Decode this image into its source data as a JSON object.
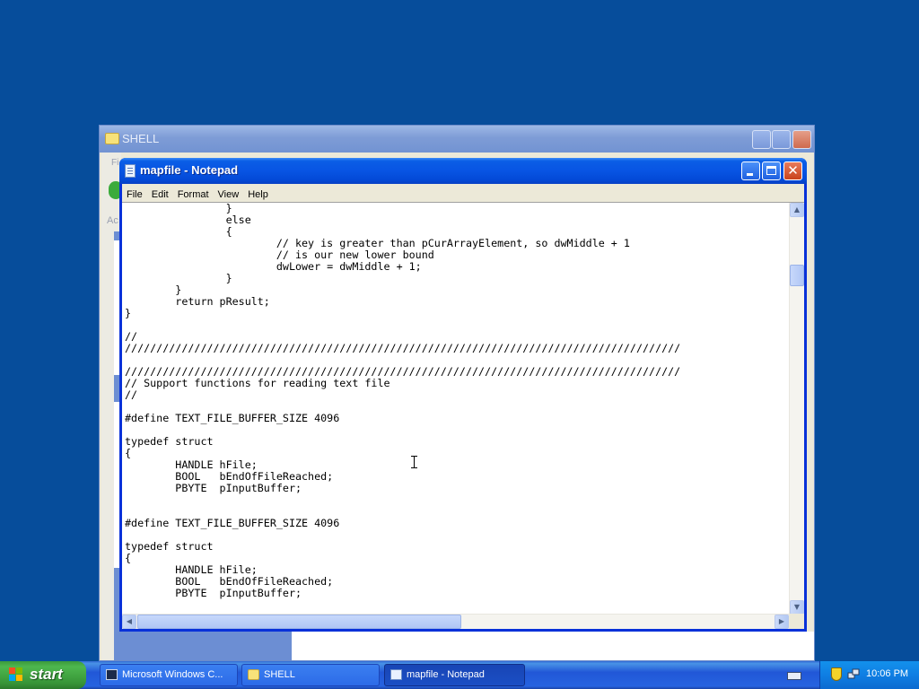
{
  "shell_window": {
    "title": "SHELL",
    "fragment_menu": "Fi",
    "fragment_address": "Ac"
  },
  "notepad": {
    "title": "mapfile - Notepad",
    "menu": [
      "File",
      "Edit",
      "Format",
      "View",
      "Help"
    ],
    "lines": [
      "                }",
      "                else",
      "                {",
      "                        // key is greater than pCurArrayElement, so dwMiddle + 1",
      "                        // is our new lower bound",
      "                        dwLower = dwMiddle + 1;",
      "                }",
      "        }",
      "        return pResult;",
      "}",
      "",
      "//",
      "////////////////////////////////////////////////////////////////////////////////////////",
      "",
      "////////////////////////////////////////////////////////////////////////////////////////",
      "// Support functions for reading text file",
      "//",
      "",
      "#define TEXT_FILE_BUFFER_SIZE 4096",
      "",
      "typedef struct",
      "{",
      "        HANDLE hFile;",
      "        BOOL   bEndOfFileReached;",
      "        PBYTE  pInputBuffer;",
      "",
      "",
      "#define TEXT_FILE_BUFFER_SIZE 4096",
      "",
      "typedef struct",
      "{",
      "        HANDLE hFile;",
      "        BOOL   bEndOfFileReached;",
      "        PBYTE  pInputBuffer;"
    ]
  },
  "taskbar": {
    "start_label": "start",
    "tasks": [
      {
        "label": "Microsoft Windows C...",
        "icon": "console-icon"
      },
      {
        "label": "SHELL",
        "icon": "folder-icon"
      },
      {
        "label": "mapfile - Notepad",
        "icon": "notepad-icon",
        "active": true
      }
    ],
    "clock": "10:06 PM"
  },
  "colors": {
    "desktop": "#064d9b",
    "title_active": "#0854e3",
    "taskbar": "#2157d7",
    "start_green": "#379437",
    "tray": "#0f7ee3"
  }
}
